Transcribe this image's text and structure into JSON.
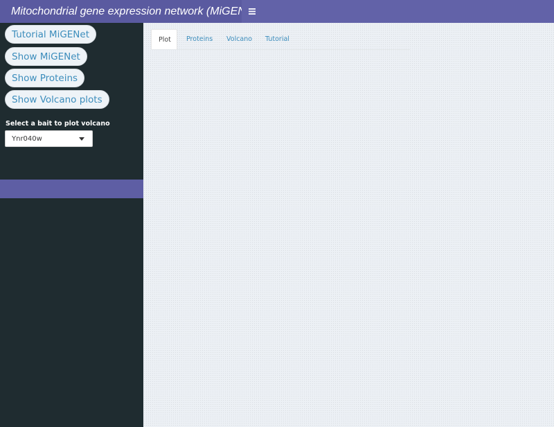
{
  "header": {
    "title": "Mitochondrial gene expression network (MiGENet)",
    "toggle_icon": "hamburger-menu-icon"
  },
  "sidebar": {
    "buttons": [
      {
        "label": "Tutorial MiGENet"
      },
      {
        "label": "Show MiGENet"
      },
      {
        "label": "Show Proteins"
      },
      {
        "label": "Show Volcano plots"
      }
    ],
    "select_label": "Select a bait to plot volcano",
    "select_value": "Ynr040w"
  },
  "main": {
    "tabs": [
      {
        "label": "Plot",
        "active": true
      },
      {
        "label": "Proteins",
        "active": false
      },
      {
        "label": "Volcano",
        "active": false
      },
      {
        "label": "Tutorial",
        "active": false
      }
    ]
  },
  "colors": {
    "brand_bg": "#5a5aa0",
    "navbar_bg": "#6262a8",
    "sidebar_bg": "#1f2c30",
    "link": "#3c8dbc",
    "content_bg": "#ecf0f5"
  }
}
